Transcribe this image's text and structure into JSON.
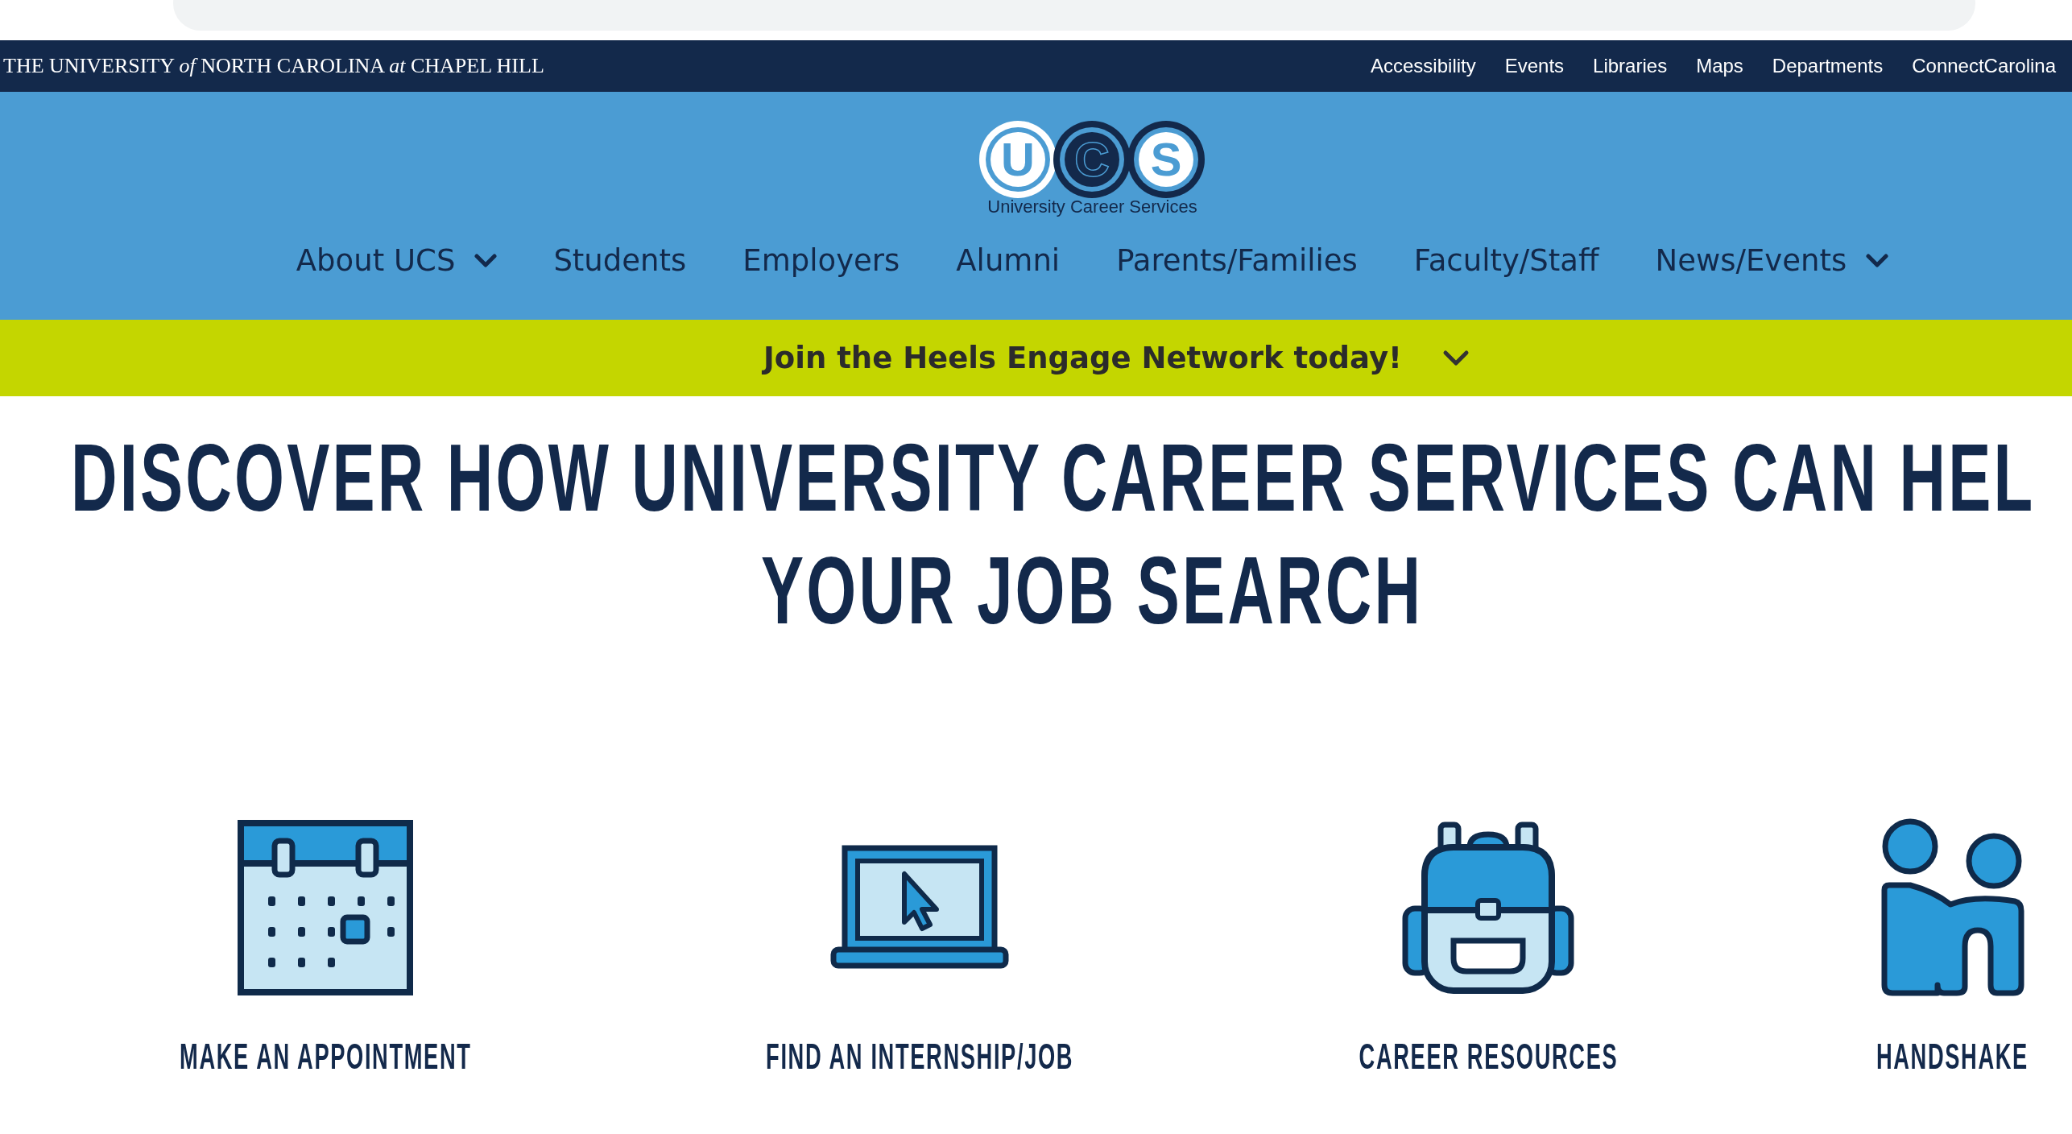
{
  "university_bar": {
    "name": "THE UNIVERSITY *of* NORTH CAROLINA *at* CHAPEL HILL",
    "links": [
      "Accessibility",
      "Events",
      "Libraries",
      "Maps",
      "Departments",
      "ConnectCarolina"
    ]
  },
  "logo": {
    "letters": [
      "U",
      "C",
      "S"
    ],
    "caption": "University Career Services"
  },
  "nav": [
    {
      "label": "About UCS",
      "dropdown": true
    },
    {
      "label": "Students",
      "dropdown": false
    },
    {
      "label": "Employers",
      "dropdown": false
    },
    {
      "label": "Alumni",
      "dropdown": false
    },
    {
      "label": "Parents/Families",
      "dropdown": false
    },
    {
      "label": "Faculty/Staff",
      "dropdown": false
    },
    {
      "label": "News/Events",
      "dropdown": true
    }
  ],
  "banner": {
    "text": "Join the Heels Engage Network today!",
    "expanded": false
  },
  "heading": [
    "DISCOVER HOW UNIVERSITY CAREER SERVICES CAN HEL",
    "YOUR JOB SEARCH"
  ],
  "tiles": [
    {
      "kind": "calendar",
      "label": "MAKE AN APPOINTMENT"
    },
    {
      "kind": "laptop",
      "label": "FIND AN INTERNSHIP/JOB"
    },
    {
      "kind": "backpack",
      "label": "CAREER RESOURCES"
    },
    {
      "kind": "handshake",
      "label": "HANDSHAKE"
    }
  ]
}
